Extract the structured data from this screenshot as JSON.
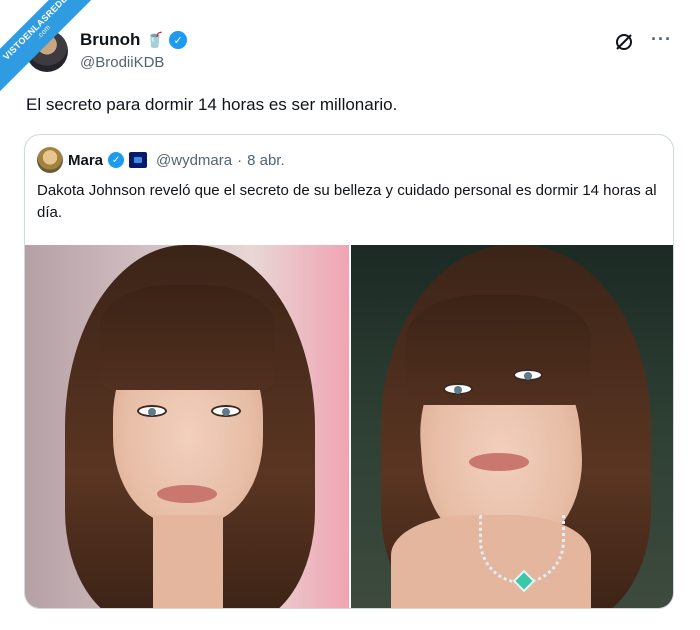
{
  "watermark": {
    "line1": "VISTOENLASREDES",
    "line2": ".com"
  },
  "tweet": {
    "author_name": "Brunoh",
    "author_emoji": "🥤",
    "author_handle": "@BrodiiKDB",
    "text": "El secreto para dormir 14 horas es ser millonario."
  },
  "quote": {
    "author_name": "Mara",
    "author_handle": "@wydmara",
    "separator": "·",
    "date": "8 abr.",
    "text": "Dakota Johnson reveló que el secreto de su belleza y cuidado personal es dormir 14 horas al día."
  },
  "icons": {
    "verified": "verified-badge-icon",
    "grok": "grok-icon",
    "more": "more-options-icon"
  },
  "colors": {
    "accent": "#1d9bf0",
    "secondary_text": "#536471",
    "border": "#cfd9de"
  }
}
